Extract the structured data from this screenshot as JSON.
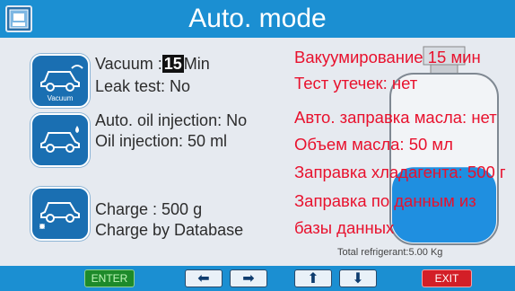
{
  "header": {
    "title": "Auto. mode",
    "home_icon": "home-icon"
  },
  "vacuum": {
    "icon_caption": "Vacuum",
    "label": "Vacuum :",
    "minutes": "15",
    "unit": "Min",
    "leak_test": "Leak  test: No"
  },
  "oil": {
    "line1": "Auto. oil injection: No",
    "line2": "Oil injection:  50 ml"
  },
  "charge": {
    "line1": "Charge : 500 g",
    "line2": "Charge by Database"
  },
  "overlay_ru": [
    "Вакуумирование 15 мин",
    "Тест утечек: нет",
    "Авто. заправка масла: нет",
    "Объем масла: 50 мл",
    "Заправка хладагента: 500 г",
    "Заправка по данным из",
    "базы данных"
  ],
  "cylinder": {
    "total": "Total refrigerant:5.00 Kg",
    "fill_level": 0.45,
    "fill_color": "#1f8fe0"
  },
  "footer": {
    "enter": "ENTER",
    "left": "⬅",
    "right": "➡",
    "up": "⬆",
    "down": "⬇",
    "exit": "EXIT"
  },
  "colors": {
    "accent": "#1b8fd2",
    "overlay_text": "#e8112d",
    "enter": "#1d8a2a",
    "exit": "#d31f27"
  }
}
